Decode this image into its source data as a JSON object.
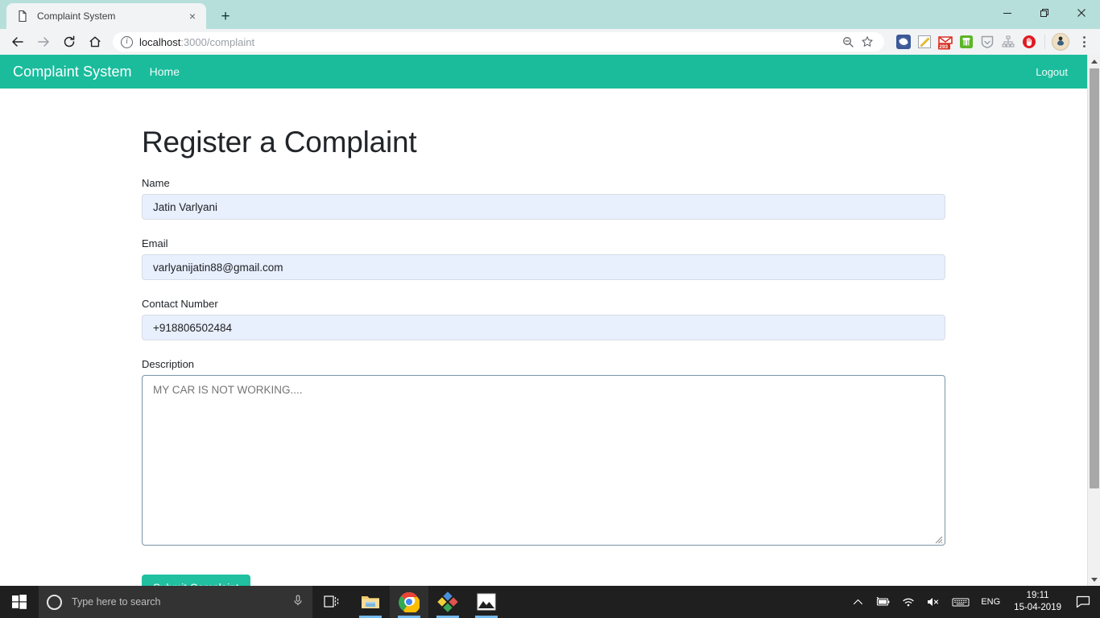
{
  "browser": {
    "tab": {
      "title": "Complaint System",
      "favicon": "page-icon",
      "close_label": "×"
    },
    "new_tab_label": "+",
    "window_controls": {
      "minimize": "—",
      "maximize": "❐",
      "close": "✕"
    },
    "toolbar": {
      "back": "←",
      "forward": "→",
      "reload": "⟳",
      "home": "⌂",
      "url_secure": "localhost",
      "url_path": ":3000/complaint",
      "url_full": "localhost:3000/complaint",
      "zoom_icon": "zoom-out-icon",
      "bookmark_icon": "star-icon",
      "extensions": [
        {
          "name": "pocket-extension",
          "color": "#3b5998"
        },
        {
          "name": "notepad-extension",
          "color": "#f5c330"
        },
        {
          "name": "gmail-checker-extension",
          "color": "#d93025",
          "badge": "293"
        },
        {
          "name": "evernote-extension",
          "color": "#5cb527"
        },
        {
          "name": "lastpass-extension",
          "color": "#9aa0a6"
        },
        {
          "name": "sitemap-extension",
          "color": "#9aa0a6"
        },
        {
          "name": "adblock-extension",
          "color": "#e01b24"
        }
      ],
      "profile": "avatar",
      "menu": "three-dot-menu"
    }
  },
  "app": {
    "navbar": {
      "brand": "Complaint System",
      "home_link": "Home",
      "logout_link": "Logout",
      "background": "#1abc9c"
    },
    "page_title": "Register a Complaint",
    "form": {
      "fields": [
        {
          "label": "Name",
          "value": "Jatin Varlyani",
          "placeholder": ""
        },
        {
          "label": "Email",
          "value": "varlyanijatin88@gmail.com",
          "placeholder": ""
        },
        {
          "label": "Contact Number",
          "value": "+918806502484",
          "placeholder": ""
        }
      ],
      "description": {
        "label": "Description",
        "value": "",
        "placeholder": "MY CAR IS NOT WORKING...."
      },
      "submit_label": "Submit Complaint",
      "submit_color": "#20c0a0"
    }
  },
  "taskbar": {
    "start": "windows-logo",
    "search_placeholder": "Type here to search",
    "mic": "microphone-icon",
    "task_view": "task-view-icon",
    "apps": [
      {
        "name": "file-explorer",
        "running": true
      },
      {
        "name": "google-chrome",
        "running": true,
        "active": true
      },
      {
        "name": "pinnacle-studio",
        "running": true
      },
      {
        "name": "photos",
        "running": true
      }
    ],
    "tray": {
      "chevron": "show-hidden-icons",
      "battery": "battery-charging-icon",
      "network": "wifi-icon",
      "volume": "volume-muted-icon",
      "keyboard": "keyboard-icon",
      "language": "ENG",
      "time": "19:11",
      "date": "15-04-2019",
      "notifications": "action-center-icon"
    }
  }
}
